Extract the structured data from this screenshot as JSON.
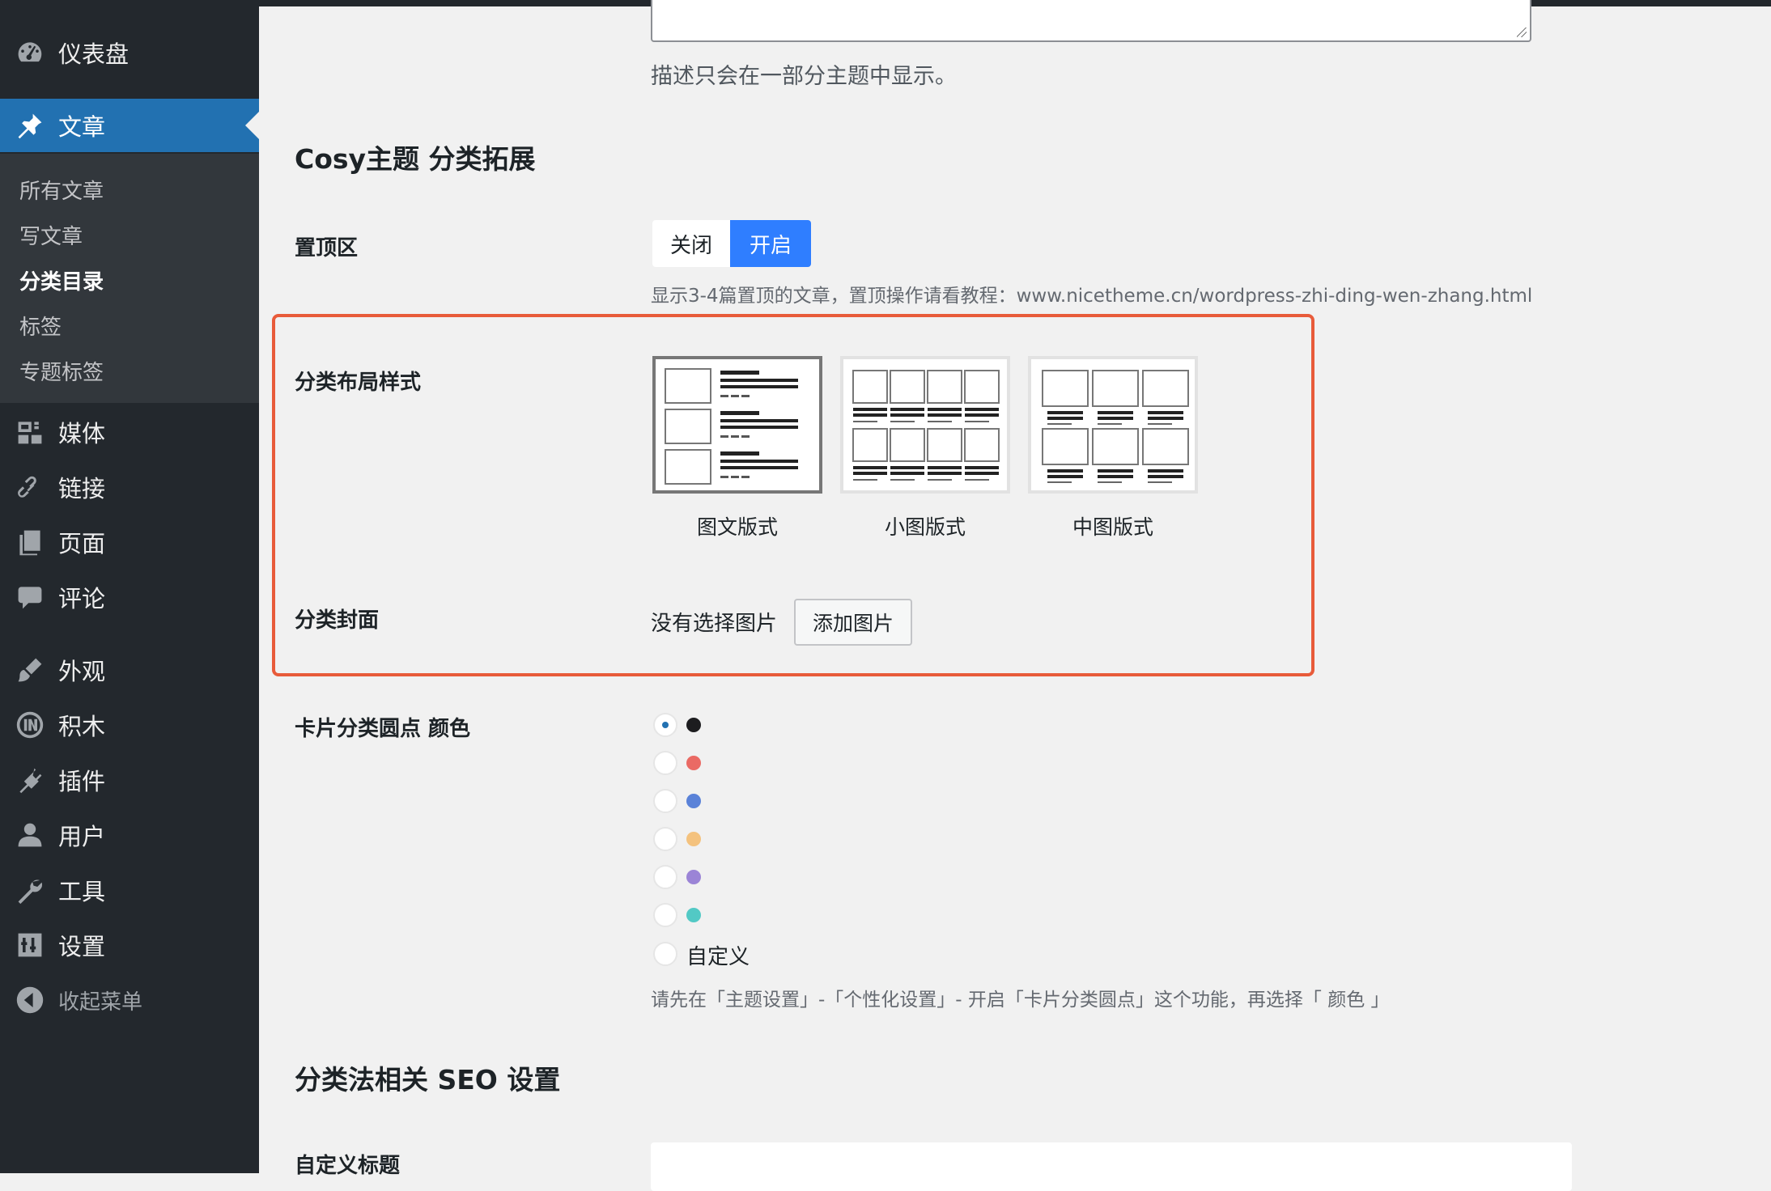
{
  "sidebar": {
    "menu": [
      {
        "label": "仪表盘",
        "icon": "dashboard-icon"
      },
      {
        "label": "文章",
        "icon": "pin-icon",
        "current": true
      },
      {
        "label": "媒体",
        "icon": "media-icon"
      },
      {
        "label": "链接",
        "icon": "link-icon"
      },
      {
        "label": "页面",
        "icon": "page-icon"
      },
      {
        "label": "评论",
        "icon": "comment-icon"
      },
      {
        "label": "外观",
        "icon": "appearance-icon"
      },
      {
        "label": "积木",
        "icon": "blocks-icon"
      },
      {
        "label": "插件",
        "icon": "plugin-icon"
      },
      {
        "label": "用户",
        "icon": "user-icon"
      },
      {
        "label": "工具",
        "icon": "wrench-icon"
      },
      {
        "label": "设置",
        "icon": "settings-icon"
      }
    ],
    "submenu": [
      {
        "label": "所有文章"
      },
      {
        "label": "写文章"
      },
      {
        "label": "分类目录",
        "current": true
      },
      {
        "label": "标签"
      },
      {
        "label": "专题标签"
      }
    ],
    "collapse": {
      "label": "收起菜单",
      "icon": "collapse-arrow-icon"
    }
  },
  "main": {
    "description_hint": "描述只会在一部分主题中显示。",
    "cosy_section_title": "Cosy主题 分类拓展",
    "sticky": {
      "label": "置顶区",
      "off_label": "关闭",
      "on_label": "开启",
      "selected": "开启",
      "hint": "显示3-4篇置顶的文章，置顶操作请看教程：www.nicetheme.cn/wordpress-zhi-ding-wen-zhang.html"
    },
    "layout": {
      "label": "分类布局样式",
      "options": [
        {
          "caption": "图文版式",
          "selected": true
        },
        {
          "caption": "小图版式",
          "selected": false
        },
        {
          "caption": "中图版式",
          "selected": false
        }
      ]
    },
    "cover": {
      "label": "分类封面",
      "status_text": "没有选择图片",
      "button_label": "添加图片"
    },
    "card_dot_color": {
      "label": "卡片分类圆点 颜色",
      "options": [
        {
          "color": "#1d1d1f",
          "checked": true
        },
        {
          "color": "#ea6a64",
          "checked": false
        },
        {
          "color": "#5a82d8",
          "checked": false
        },
        {
          "color": "#f4c27e",
          "checked": false
        },
        {
          "color": "#9b84d6",
          "checked": false
        },
        {
          "color": "#52c9c5",
          "checked": false
        }
      ],
      "custom_label": "自定义",
      "hint": "请先在「主题设置」-「个性化设置」- 开启「卡片分类圆点」这个功能，再选择「 颜色 」"
    },
    "seo_section_title": "分类法相关 SEO 设置",
    "custom_title": {
      "label": "自定义标题"
    }
  },
  "colors": {
    "sidebar_bg": "#23282d",
    "submenu_bg": "#32373c",
    "active_menu": "#2271b1",
    "toggle_on": "#2f7eff",
    "highlight_border": "#e85b3a"
  }
}
